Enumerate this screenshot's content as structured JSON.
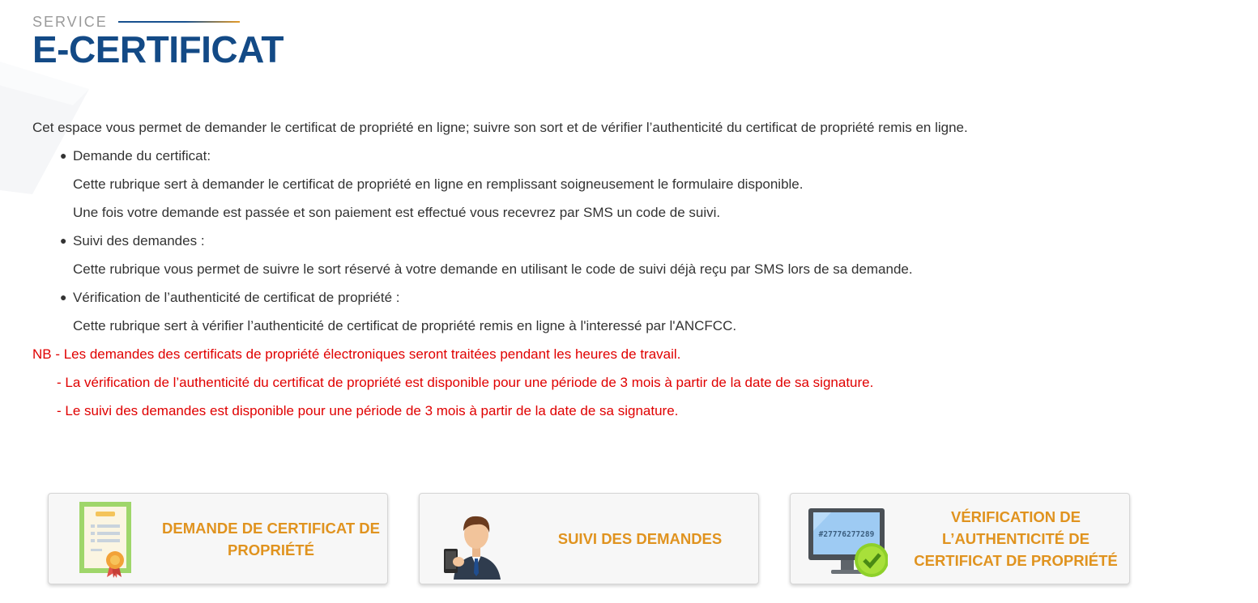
{
  "header": {
    "eyebrow": "SERVICE",
    "title": "E-CERTIFICAT"
  },
  "content": {
    "intro": "Cet espace vous permet de demander le certificat de propriété en ligne; suivre son sort et de vérifier l’authenticité du certificat de propriété remis en ligne.",
    "items": [
      {
        "title": "Demande du certificat:",
        "lines": [
          "Cette rubrique sert à demander le certificat de propriété en ligne en remplissant soigneusement le formulaire disponible.",
          "Une fois votre demande est passée et son paiement est effectué vous recevrez par SMS un code de suivi."
        ]
      },
      {
        "title": "Suivi des demandes :",
        "lines": [
          "Cette rubrique vous permet de suivre le sort réservé à votre demande en utilisant le code de suivi déjà reçu par SMS lors de sa demande."
        ]
      },
      {
        "title": "Vérification de l’authenticité de certificat de propriété :",
        "lines": [
          "Cette rubrique sert à vérifier l’authenticité de certificat de propriété remis en ligne à l'interessé par l'ANCFCC."
        ]
      }
    ],
    "notes": [
      "NB - Les demandes des certificats de propriété électroniques seront traitées pendant les heures de travail.",
      "- La vérification de l’authenticité du certificat de propriété est disponible pour une période de 3 mois à partir de la date de sa signature.",
      "- Le suivi des demandes est disponible pour une période de 3 mois à partir de la date de sa signature."
    ]
  },
  "cards": [
    {
      "label": "DEMANDE DE CERTIFICAT DE PROPRIÉTÉ",
      "icon": "certificate-icon"
    },
    {
      "label": "SUIVI DES DEMANDES",
      "icon": "agent-phone-icon"
    },
    {
      "label": "VÉRIFICATION DE L’AUTHENTICITÉ DE CERTIFICAT DE PROPRIÉTÉ",
      "icon": "monitor-check-icon",
      "screen_code": "#27776277289"
    }
  ],
  "colors": {
    "title": "#134a86",
    "card_label": "#e0931f",
    "note": "#e00000",
    "accent_line_start": "#17508f",
    "accent_line_end": "#e49b27"
  }
}
